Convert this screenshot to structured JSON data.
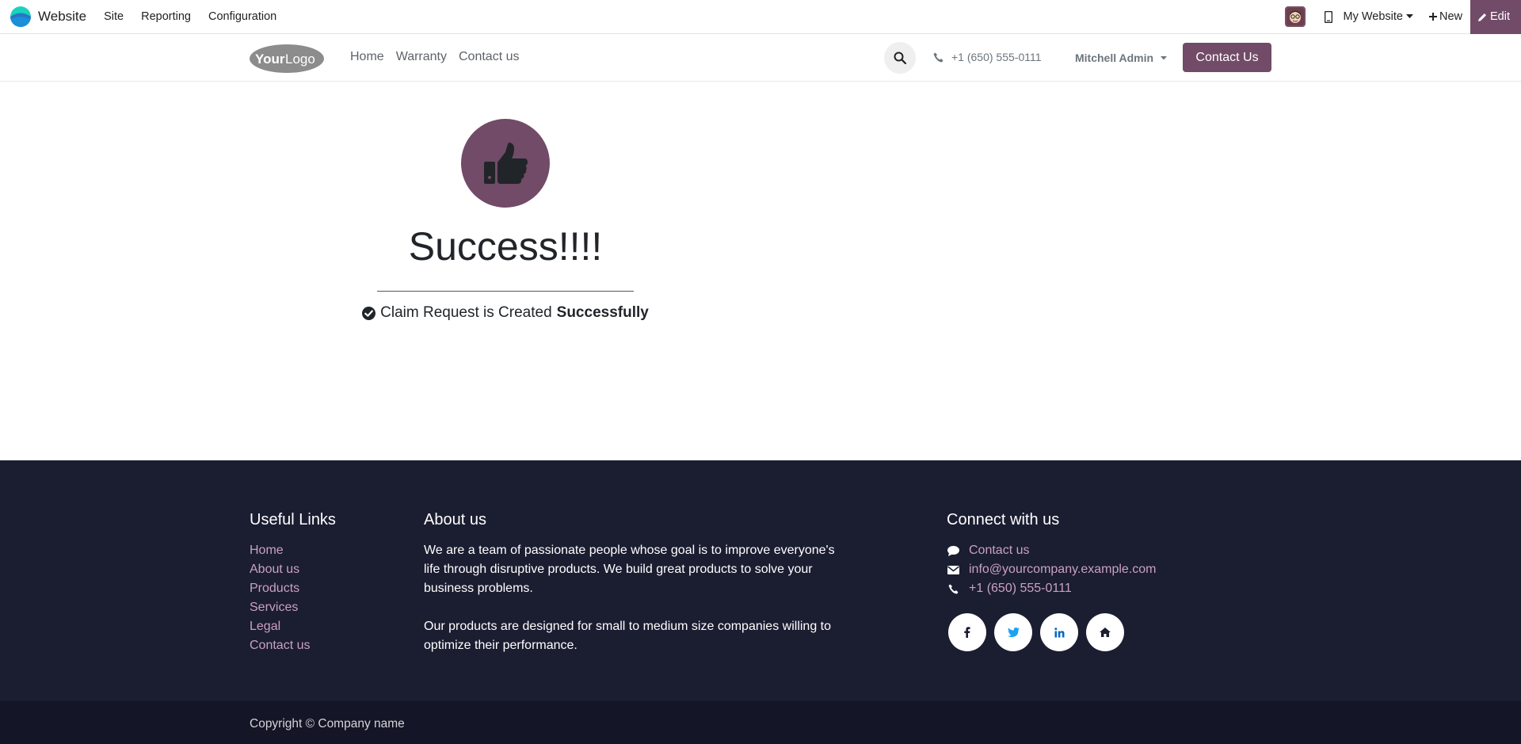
{
  "admin_bar": {
    "app_name": "Website",
    "menus": [
      "Site",
      "Reporting",
      "Configuration"
    ],
    "website_selector": "My Website",
    "new_label": "New",
    "edit_label": "Edit"
  },
  "header": {
    "logo_text": "YourLogo",
    "nav": [
      "Home",
      "Warranty",
      "Contact us"
    ],
    "phone": "+1 (650) 555-0111",
    "user": "Mitchell Admin",
    "cta": "Contact Us"
  },
  "main": {
    "title": "Success!!!!",
    "message_prefix": "Claim Request is Created",
    "message_bold": "Successfully"
  },
  "footer": {
    "useful_links": {
      "heading": "Useful Links",
      "links": [
        "Home",
        "About us",
        "Products",
        "Services",
        "Legal",
        "Contact us"
      ]
    },
    "about": {
      "heading": "About us",
      "paragraph1": "We are a team of passionate people whose goal is to improve everyone's life through disruptive products. We build great products to solve your business problems.",
      "paragraph2": "Our products are designed for small to medium size companies willing to optimize their performance."
    },
    "connect": {
      "heading": "Connect with us",
      "contact": "Contact us",
      "email": "info@yourcompany.example.com",
      "phone": "+1 (650) 555-0111",
      "socials": [
        "facebook-icon",
        "twitter-icon",
        "linkedin-icon",
        "home-icon"
      ]
    },
    "copyright": "Copyright © Company name"
  },
  "colors": {
    "brand": "#714b67",
    "footer_bg": "#1b1d31",
    "copyright_bg": "#141526",
    "footer_link": "#c9a2bf"
  }
}
